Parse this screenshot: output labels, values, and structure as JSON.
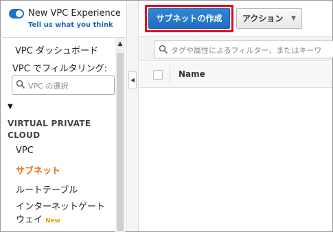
{
  "sidebar": {
    "experience_title": "New VPC Experience",
    "experience_link": "Tell us what you think",
    "dashboard_label": "VPC ダッシュボード",
    "filter_label": "VPC でフィルタリング:",
    "vpc_select_placeholder": "VPC の選択",
    "section_title": "VIRTUAL PRIVATE CLOUD",
    "items": [
      {
        "label": "VPC"
      },
      {
        "label": "サブネット"
      },
      {
        "label": "ルートテーブル"
      },
      {
        "label": "インターネットゲートウェイ"
      }
    ],
    "new_badge": "New"
  },
  "toolbar": {
    "create_subnet_label": "サブネットの作成",
    "actions_label": "アクション"
  },
  "filter": {
    "placeholder": "タグや属性によるフィルター、またはキーワ"
  },
  "table": {
    "columns": [
      "Name"
    ]
  },
  "colors": {
    "accent": "#1f6fbd",
    "active_nav": "#e0711c",
    "highlight_border": "#e8001c",
    "new_badge": "#e0a000"
  }
}
